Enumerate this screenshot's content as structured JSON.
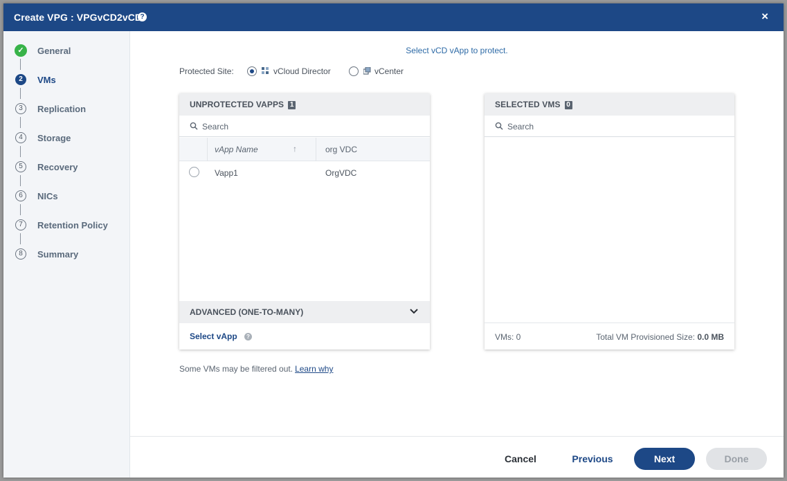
{
  "dialog": {
    "title": "Create VPG : VPGvCD2vCD",
    "help_glyph": "?",
    "close_glyph": "×"
  },
  "steps": [
    {
      "num": "✓",
      "label": "General",
      "state": "done"
    },
    {
      "num": "2",
      "label": "VMs",
      "state": "active"
    },
    {
      "num": "3",
      "label": "Replication",
      "state": "pending"
    },
    {
      "num": "4",
      "label": "Storage",
      "state": "pending"
    },
    {
      "num": "5",
      "label": "Recovery",
      "state": "pending"
    },
    {
      "num": "6",
      "label": "NICs",
      "state": "pending"
    },
    {
      "num": "7",
      "label": "Retention Policy",
      "state": "pending"
    },
    {
      "num": "8",
      "label": "Summary",
      "state": "pending"
    }
  ],
  "main": {
    "subtitle": "Select vCD vApp to protect.",
    "protected_site": {
      "label": "Protected Site:",
      "options": [
        {
          "label": "vCloud Director",
          "checked": true
        },
        {
          "label": "vCenter",
          "checked": false
        }
      ]
    },
    "unprotected": {
      "title": "UNPROTECTED VAPPS",
      "count": "1",
      "search_placeholder": "Search",
      "columns": [
        "vApp Name",
        "org VDC"
      ],
      "rows": [
        {
          "name": "Vapp1",
          "org_vdc": "OrgVDC"
        }
      ],
      "advanced_label": "ADVANCED (ONE-TO-MANY)",
      "select_vapp_label": "Select vApp"
    },
    "selected": {
      "title": "SELECTED VMS",
      "count": "0",
      "search_placeholder": "Search",
      "vms_label": "VMs: 0",
      "provisioned_label": "Total VM Provisioned Size:",
      "provisioned_value": "0.0 MB"
    },
    "filter_note": "Some VMs may be filtered out.",
    "learn_why": "Learn why"
  },
  "footer": {
    "cancel": "Cancel",
    "previous": "Previous",
    "next": "Next",
    "done": "Done"
  },
  "colors": {
    "brand": "#1d4886",
    "success": "#38b349"
  }
}
